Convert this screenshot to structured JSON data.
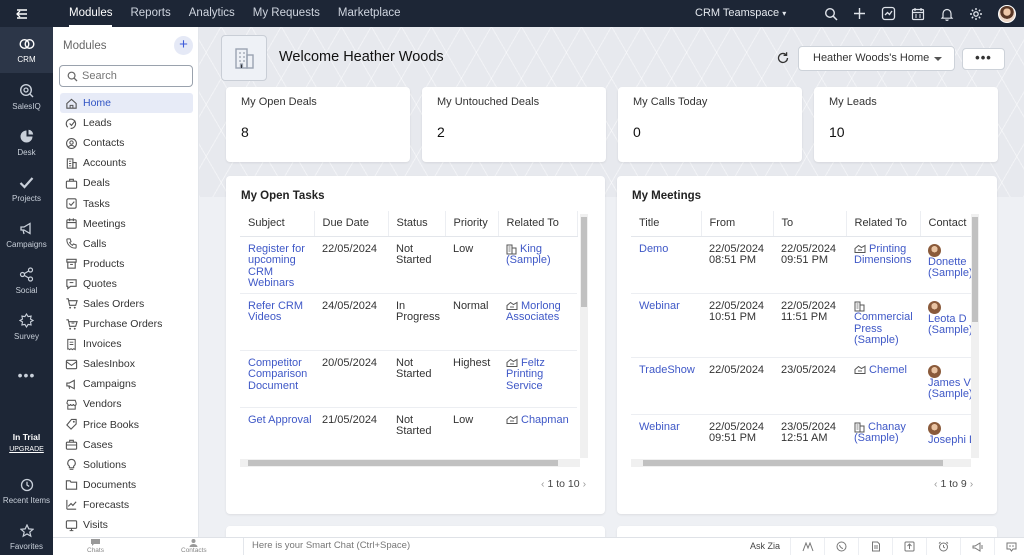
{
  "topnav": {
    "items": [
      "Modules",
      "Reports",
      "Analytics",
      "My Requests",
      "Marketplace"
    ],
    "active": "Modules",
    "teamspace": "CRM Teamspace"
  },
  "rail": {
    "items": [
      {
        "label": "CRM",
        "icon": "crm-icon"
      },
      {
        "label": "SalesIQ",
        "icon": "salesiq-icon"
      },
      {
        "label": "Desk",
        "icon": "desk-icon"
      },
      {
        "label": "Projects",
        "icon": "projects-icon"
      },
      {
        "label": "Campaigns",
        "icon": "campaigns-icon"
      },
      {
        "label": "Social",
        "icon": "social-icon"
      },
      {
        "label": "Survey",
        "icon": "survey-icon"
      }
    ],
    "trial": "In Trial",
    "upgrade": "UPGRADE",
    "recent": "Recent Items",
    "favorites": "Favorites"
  },
  "modules": {
    "title": "Modules",
    "search_placeholder": "Search",
    "items": [
      "Home",
      "Leads",
      "Contacts",
      "Accounts",
      "Deals",
      "Tasks",
      "Meetings",
      "Calls",
      "Products",
      "Quotes",
      "Sales Orders",
      "Purchase Orders",
      "Invoices",
      "SalesInbox",
      "Campaigns",
      "Vendors",
      "Price Books",
      "Cases",
      "Solutions",
      "Documents",
      "Forecasts",
      "Visits"
    ],
    "active": "Home"
  },
  "header": {
    "welcome": "Welcome Heather Woods",
    "home_select": "Heather Woods's Home",
    "more": "•••"
  },
  "stats": [
    {
      "label": "My Open Deals",
      "value": "8"
    },
    {
      "label": "My Untouched Deals",
      "value": "2"
    },
    {
      "label": "My Calls Today",
      "value": "0"
    },
    {
      "label": "My Leads",
      "value": "10"
    }
  ],
  "tasks": {
    "title": "My Open Tasks",
    "columns": [
      "Subject",
      "Due Date",
      "Status",
      "Priority",
      "Related To"
    ],
    "rows": [
      {
        "subject": "Register for upcoming CRM Webinars",
        "due": "22/05/2024",
        "status": "Not Started",
        "priority": "Low",
        "related": "King (Sample)",
        "rel_icon": "account-icon"
      },
      {
        "subject": "Refer CRM Videos",
        "due": "24/05/2024",
        "status": "In Progress",
        "priority": "Normal",
        "related": "Morlong Associates",
        "rel_icon": "deal-icon"
      },
      {
        "subject": "Competitor Comparison Document",
        "due": "20/05/2024",
        "status": "Not Started",
        "priority": "Highest",
        "related": "Feltz Printing Service",
        "rel_icon": "deal-icon"
      },
      {
        "subject": "Get Approval",
        "due": "21/05/2024",
        "status": "Not Started",
        "priority": "Low",
        "related": "Chapman",
        "rel_icon": "deal-icon"
      }
    ],
    "pager": "1 to 10"
  },
  "meetings": {
    "title": "My Meetings",
    "columns": [
      "Title",
      "From",
      "To",
      "Related To",
      "Contact"
    ],
    "rows": [
      {
        "title": "Demo",
        "from": "22/05/2024 08:51 PM",
        "to": "22/05/2024 09:51 PM",
        "related": "Printing Dimensions",
        "rel_icon": "deal-icon",
        "contact": "Donette (Sample)"
      },
      {
        "title": "Webinar",
        "from": "22/05/2024 10:51 PM",
        "to": "22/05/2024 11:51 PM",
        "related": "Commercial Press (Sample)",
        "rel_icon": "account-icon",
        "contact": "Leota D (Sample)"
      },
      {
        "title": "TradeShow",
        "from": "22/05/2024",
        "to": "23/05/2024",
        "related": "Chemel",
        "rel_icon": "deal-icon",
        "contact": "James V (Sample)"
      },
      {
        "title": "Webinar",
        "from": "22/05/2024 09:51 PM",
        "to": "23/05/2024 12:51 AM",
        "related": "Chanay (Sample)",
        "rel_icon": "account-icon",
        "contact": "Josephi Darakjy"
      }
    ],
    "pager": "1 to 9"
  },
  "bottom": {
    "chats": "Chats",
    "contacts": "Contacts",
    "smartchat": "Here is your Smart Chat (Ctrl+Space)",
    "askzia": "Ask Zia"
  }
}
